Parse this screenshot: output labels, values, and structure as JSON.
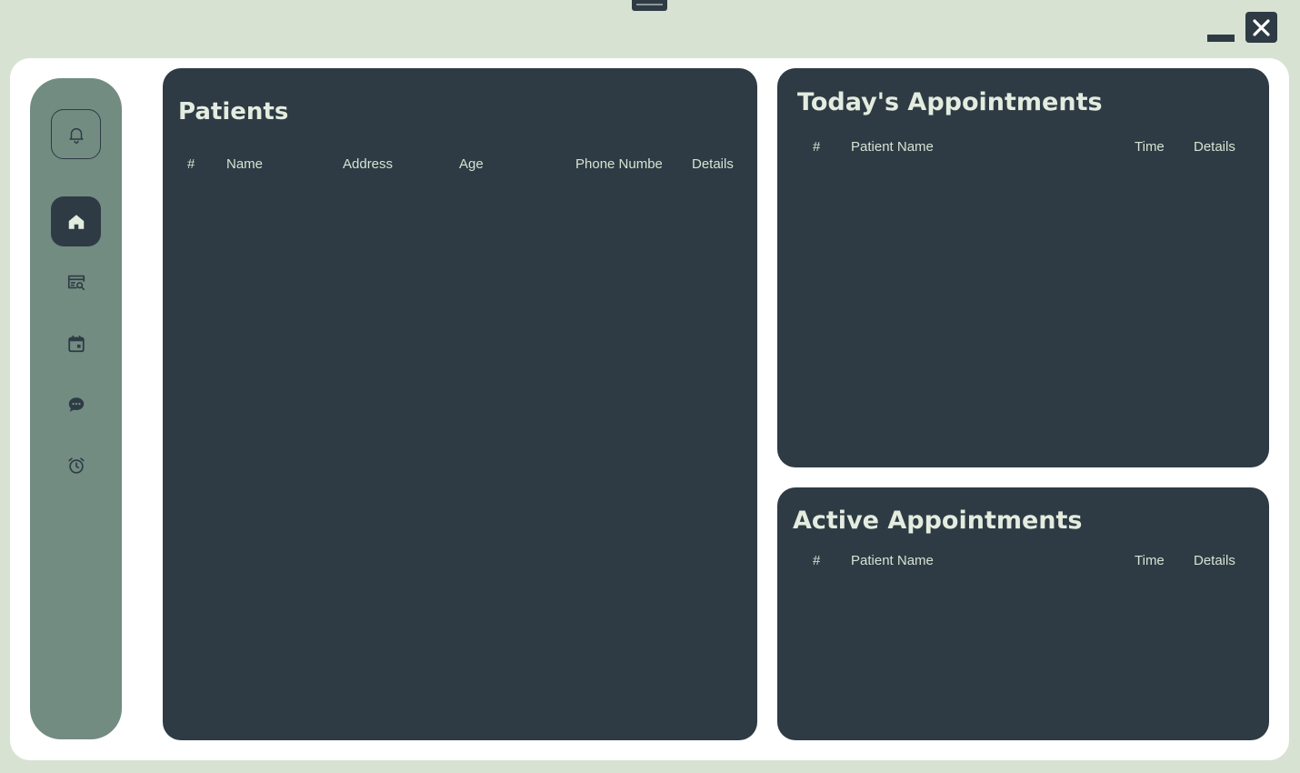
{
  "window": {
    "minimize_icon": "minimize-icon",
    "close_icon": "close-icon"
  },
  "sidebar": {
    "items": [
      {
        "icon": "bell-icon",
        "name": "notifications"
      },
      {
        "icon": "home-icon",
        "name": "home",
        "active": true
      },
      {
        "icon": "search-records-icon",
        "name": "patient-search"
      },
      {
        "icon": "calendar-icon",
        "name": "appointments"
      },
      {
        "icon": "chat-icon",
        "name": "messages"
      },
      {
        "icon": "alarm-icon",
        "name": "reminders"
      }
    ]
  },
  "patients": {
    "title": "Patients",
    "columns": {
      "num": "#",
      "name": "Name",
      "address": "Address",
      "age": "Age",
      "phone": "Phone Number",
      "details": "Details"
    },
    "rows": []
  },
  "todays_appointments": {
    "title": "Today's Appointments",
    "columns": {
      "num": "#",
      "patient_name": "Patient Name",
      "time": "Time",
      "details": "Details"
    },
    "rows": []
  },
  "active_appointments": {
    "title": "Active Appointments",
    "columns": {
      "num": "#",
      "patient_name": "Patient Name",
      "time": "Time",
      "details": "Details"
    },
    "rows": []
  },
  "colors": {
    "background": "#d7e2d3",
    "sidebar": "#728c82",
    "panel": "#2e3b44",
    "text": "#d7e2d3",
    "surface": "#ffffff"
  }
}
